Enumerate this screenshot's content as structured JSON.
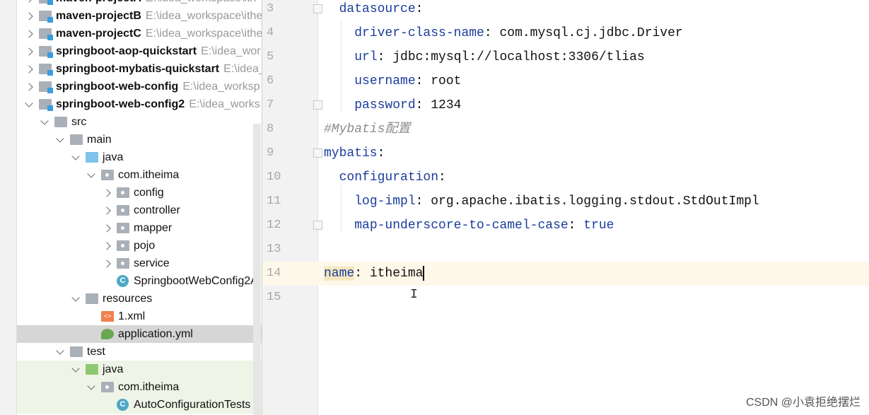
{
  "project_tree": {
    "items": [
      {
        "label": "maven-projectA",
        "path": "E:\\idea_workspace\\ith",
        "depth": 0,
        "expanded": false,
        "type": "module"
      },
      {
        "label": "maven-projectB",
        "path": "E:\\idea_workspace\\ithe",
        "depth": 0,
        "expanded": false,
        "type": "module"
      },
      {
        "label": "maven-projectC",
        "path": "E:\\idea_workspace\\ithe",
        "depth": 0,
        "expanded": false,
        "type": "module"
      },
      {
        "label": "springboot-aop-quickstart",
        "path": "E:\\idea_wor",
        "depth": 0,
        "expanded": false,
        "type": "module"
      },
      {
        "label": "springboot-mybatis-quickstart",
        "path": "E:\\idea_",
        "depth": 0,
        "expanded": false,
        "type": "module"
      },
      {
        "label": "springboot-web-config",
        "path": "E:\\idea_worksp",
        "depth": 0,
        "expanded": false,
        "type": "module"
      },
      {
        "label": "springboot-web-config2",
        "path": "E:\\idea_works",
        "depth": 0,
        "expanded": true,
        "type": "module"
      },
      {
        "label": "src",
        "depth": 1,
        "expanded": true,
        "type": "folder"
      },
      {
        "label": "main",
        "depth": 2,
        "expanded": true,
        "type": "folder"
      },
      {
        "label": "java",
        "depth": 3,
        "expanded": true,
        "type": "source"
      },
      {
        "label": "com.itheima",
        "depth": 4,
        "expanded": true,
        "type": "package"
      },
      {
        "label": "config",
        "depth": 5,
        "expanded": false,
        "type": "package"
      },
      {
        "label": "controller",
        "depth": 5,
        "expanded": false,
        "type": "package"
      },
      {
        "label": "mapper",
        "depth": 5,
        "expanded": false,
        "type": "package"
      },
      {
        "label": "pojo",
        "depth": 5,
        "expanded": false,
        "type": "package"
      },
      {
        "label": "service",
        "depth": 5,
        "expanded": false,
        "type": "package"
      },
      {
        "label": "SpringbootWebConfig2A",
        "depth": 5,
        "type": "springclass"
      },
      {
        "label": "resources",
        "depth": 3,
        "expanded": true,
        "type": "resources"
      },
      {
        "label": "1.xml",
        "depth": 4,
        "type": "xml"
      },
      {
        "label": "application.yml",
        "depth": 4,
        "type": "yml",
        "selected": true
      },
      {
        "label": "test",
        "depth": 2,
        "expanded": true,
        "type": "folder"
      },
      {
        "label": "java",
        "depth": 3,
        "expanded": true,
        "type": "testsource",
        "test": true
      },
      {
        "label": "com.itheima",
        "depth": 4,
        "expanded": true,
        "type": "package",
        "test": true
      },
      {
        "label": "AutoConfigurationTests",
        "depth": 5,
        "type": "testclass",
        "test": true
      }
    ]
  },
  "editor": {
    "lines": [
      {
        "n": "3",
        "indent": "  ",
        "key": "datasource",
        "sep": ":",
        "value": ""
      },
      {
        "n": "4",
        "indent": "    ",
        "key": "driver-class-name",
        "sep": ": ",
        "value": "com.mysql.cj.jdbc.Driver"
      },
      {
        "n": "5",
        "indent": "    ",
        "key": "url",
        "sep": ": ",
        "value": "jdbc:mysql://localhost:3306/tlias"
      },
      {
        "n": "6",
        "indent": "    ",
        "key": "username",
        "sep": ": ",
        "value": "root"
      },
      {
        "n": "7",
        "indent": "    ",
        "key": "password",
        "sep": ": ",
        "value": "1234"
      },
      {
        "n": "8",
        "comment": "#Mybatis配置"
      },
      {
        "n": "9",
        "indent": "",
        "key": "mybatis",
        "sep": ":",
        "value": ""
      },
      {
        "n": "10",
        "indent": "  ",
        "key": "configuration",
        "sep": ":",
        "value": ""
      },
      {
        "n": "11",
        "indent": "    ",
        "key": "log-impl",
        "sep": ": ",
        "value": "org.apache.ibatis.logging.stdout.StdOutImpl"
      },
      {
        "n": "12",
        "indent": "    ",
        "key": "map-underscore-to-camel-case",
        "sep": ": ",
        "value": "true",
        "value_kw": true
      },
      {
        "n": "13"
      },
      {
        "n": "14",
        "indent": "",
        "key": "name",
        "sep": ": ",
        "value": "itheima",
        "current": true
      },
      {
        "n": "15"
      }
    ]
  },
  "watermark": "CSDN @小袁拒绝摆烂"
}
